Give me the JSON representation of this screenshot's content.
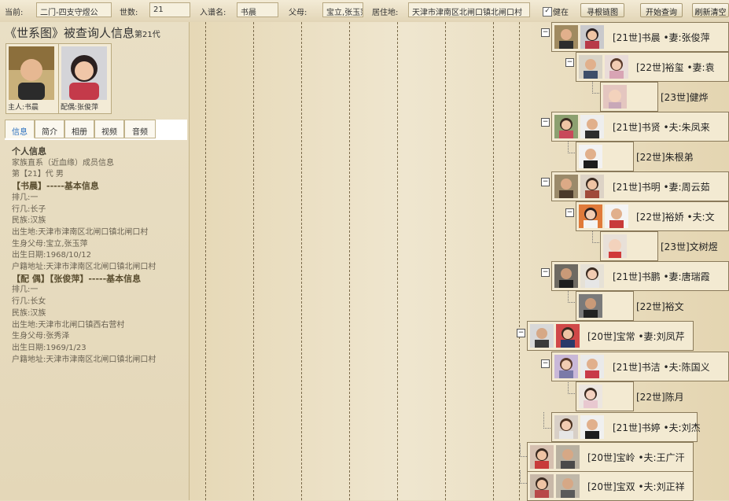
{
  "search": {
    "label_current": "当前:",
    "current_value": "二门-四支守煜公",
    "label_generation": "世数:",
    "generation_value": "21",
    "label_name": "入谱名:",
    "name_value": "书晨",
    "label_parents": "父母:",
    "parents_value": "宝立,张玉萍",
    "label_residence": "居住地:",
    "residence_value": "天津市津南区北闸口镇北闸口村",
    "alive_label": "健在",
    "alive_checked": true,
    "btn_find_chain": "寻根链图",
    "btn_query": "开始查询",
    "btn_refresh": "刷新清空"
  },
  "profile": {
    "title": "《世系图》被查询人信息",
    "title_gen": "第21代",
    "owner_caption": "主人:书晨",
    "spouse_caption": "配偶:张俊萍",
    "tabs": [
      "信息",
      "简介",
      "相册",
      "视频",
      "音频"
    ],
    "active_tab": "信息",
    "info": {
      "section": "个人信息",
      "subtitle": "家族直系（近血缘）成员信息",
      "gen_line": "第【21】代 男",
      "self_header": "【书晨】-----基本信息",
      "self": [
        "排几:一",
        "行几:长子",
        "民族:汉族",
        "出生地:天津市津南区北闸口镇北闸口村",
        "生身父母:宝立,张玉萍",
        "出生日期:1968/10/12",
        "户籍地址:天津市津南区北闸口镇北闸口村"
      ],
      "spouse_header": "【配 偶】【张俊萍】-----基本信息",
      "spouse": [
        "排几:一",
        "行几:长女",
        "民族:汉族",
        "出生地:天津市北闸口镇西右营村",
        "生身父母:张秀泽",
        "出生日期:1969/1/23",
        "户籍地址:天津市津南区北闸口镇北闸口村"
      ]
    }
  },
  "tree": {
    "nodes": [
      {
        "label": "[21世]书晨 •妻:张俊萍"
      },
      {
        "label": "[22世]裕玺 •妻:袁"
      },
      {
        "label": "[23世]健烨"
      },
      {
        "label": "[21世]书贤 •夫:朱凤来"
      },
      {
        "label": "[22世]朱根弟"
      },
      {
        "label": "[21世]书明 •妻:周云茹"
      },
      {
        "label": "[22世]裕娇 •夫:文"
      },
      {
        "label": "[23世]文树煜"
      },
      {
        "label": "[21世]书鹏 •妻:唐瑞霞"
      },
      {
        "label": "[22世]裕文"
      },
      {
        "label": "[20世]宝常 •妻:刘凤芹"
      },
      {
        "label": "[21世]书洁 •夫:陈国义"
      },
      {
        "label": "[22世]陈月"
      },
      {
        "label": "[21世]书婷 •夫:刘杰"
      },
      {
        "label": "[20世]宝岭 •夫:王广汗"
      },
      {
        "label": "[20世]宝双 •夫:刘正祥"
      }
    ]
  },
  "colors": {
    "panel_bg": "#e9dfc5",
    "accent_tab": "#2a6fbf"
  }
}
